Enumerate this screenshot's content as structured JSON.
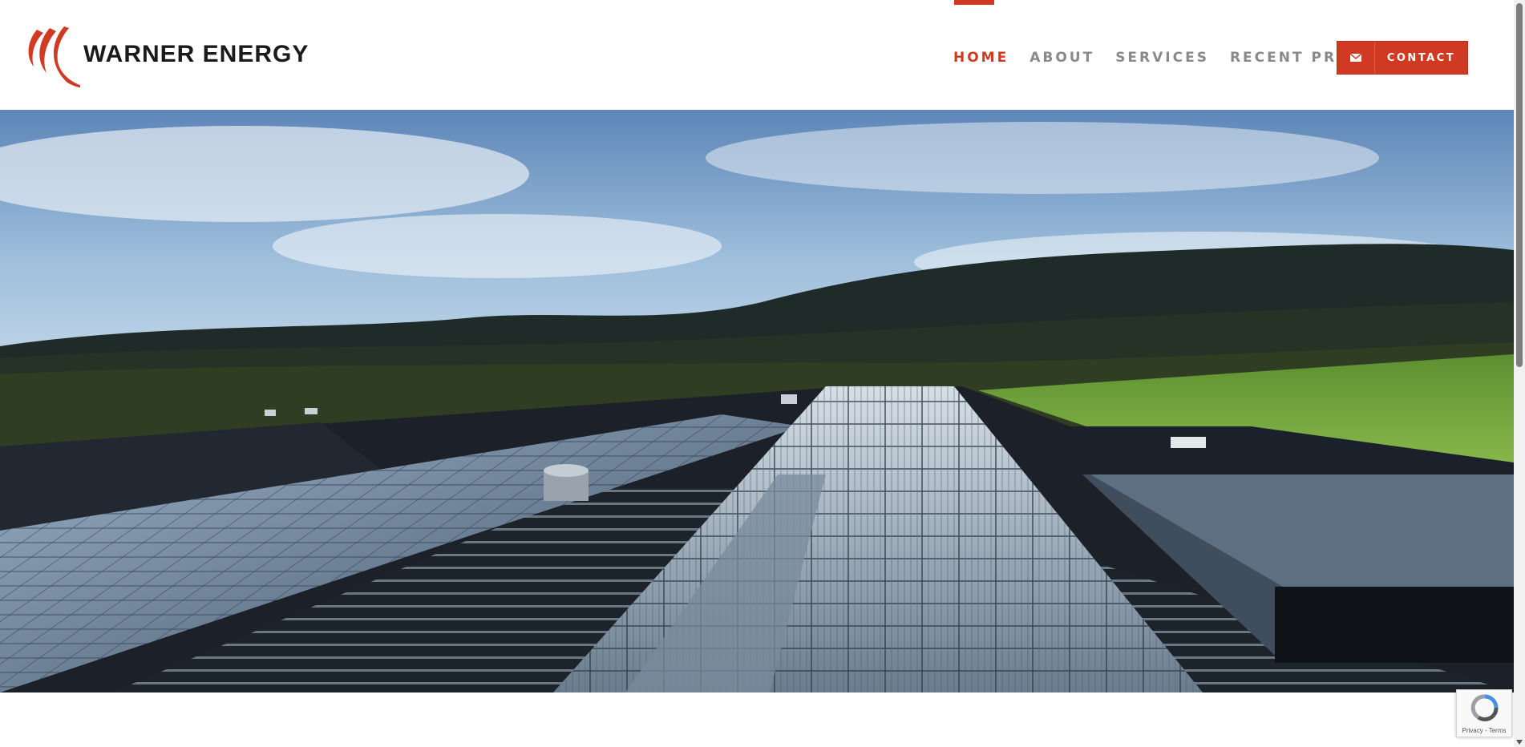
{
  "brand": {
    "name": "WARNER ENERGY"
  },
  "nav": {
    "items": [
      {
        "label": "HOME",
        "active": true
      },
      {
        "label": "ABOUT",
        "active": false
      },
      {
        "label": "SERVICES",
        "active": false
      },
      {
        "label": "RECENT PROJECTS",
        "active": false
      }
    ],
    "contact_label": "CONTACT",
    "contact_icon": "envelope-icon"
  },
  "colors": {
    "accent": "#d03a22",
    "nav_text": "#8a8a8a",
    "brand_text": "#1a1a1a"
  },
  "recaptcha": {
    "links": "Privacy - Terms"
  }
}
